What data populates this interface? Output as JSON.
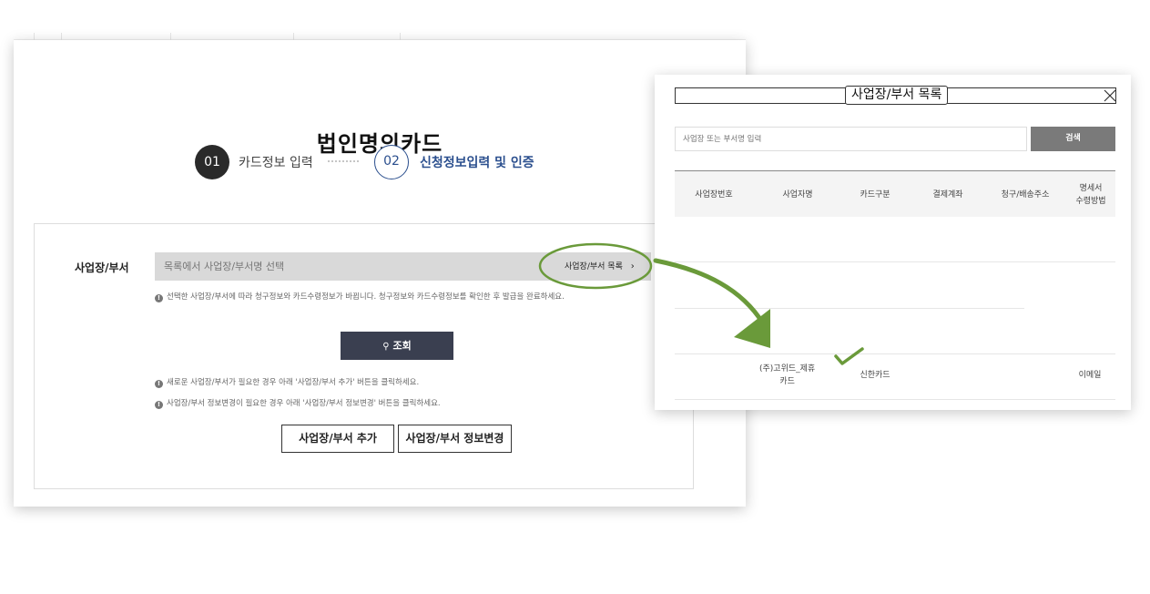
{
  "page": {
    "title": "법인명의카드",
    "steps": [
      {
        "number": "01",
        "label": "카드정보 입력"
      },
      {
        "number": "02",
        "label": "신청정보입력 및 인증"
      }
    ]
  },
  "form": {
    "field_label": "사업장/부서",
    "select_placeholder": "목록에서 사업장/부서명 선택",
    "list_button_label": "사업장/부서 목록",
    "notice_change": "선택한 사업장/부서에 따라 청구정보와 카드수령정보가 바뀝니다. 청구정보와 카드수령정보를 확인한 후 발급을 완료하세요.",
    "search_button_label": "조회",
    "notice_add": "새로운 사업장/부서가 필요한 경우 아래 '사업장/부서 추가' 버튼을 클릭하세요.",
    "notice_edit": "사업장/부서 정보변경이 필요한 경우 아래 '사업장/부서 정보변경' 버튼을 클릭하세요.",
    "add_button_label": "사업장/부서 추가",
    "edit_button_label": "사업장/부서 정보변경"
  },
  "popup": {
    "title": "사업장/부서 목록",
    "search_placeholder": "사업장 또는 부서명 입력",
    "search_button_label": "검색",
    "columns": [
      "사업장번호",
      "사업자명",
      "카드구분",
      "결제계좌",
      "청구/배송주소",
      "명세서\n수령방법"
    ],
    "rows": [
      {
        "business_name": "(주)고위드_제휴\n카드",
        "card_type": "신한카드",
        "statement_method": "이메일"
      }
    ]
  },
  "colors": {
    "accent_blue": "#2b4f8e",
    "annotation_green": "#6a9a3a",
    "dark_button": "#3a3f50"
  }
}
